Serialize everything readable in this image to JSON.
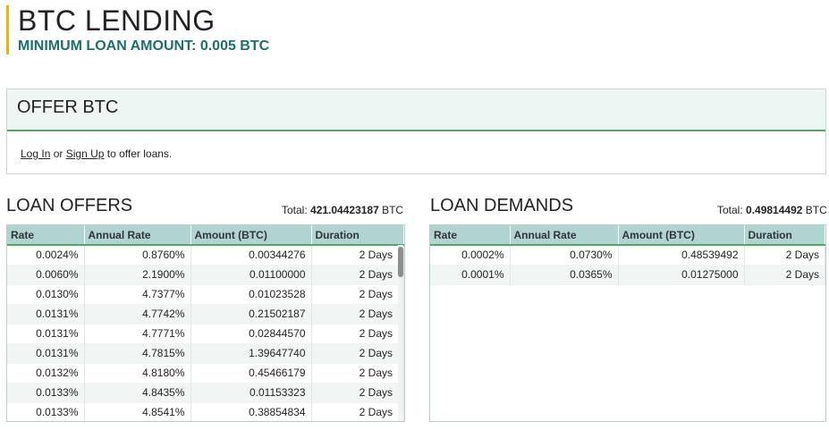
{
  "header": {
    "title": "BTC LENDING",
    "subtitle": "MINIMUM LOAN AMOUNT: 0.005 BTC"
  },
  "offer": {
    "title": "OFFER BTC",
    "login_label": "Log In",
    "or_text": " or ",
    "signup_label": "Sign Up",
    "suffix_text": " to offer loans."
  },
  "loan_offers": {
    "title": "LOAN OFFERS",
    "total_label": "Total: ",
    "total_value": "421.04423187",
    "total_unit": " BTC",
    "columns": [
      "Rate",
      "Annual Rate",
      "Amount (BTC)",
      "Duration"
    ],
    "rows": [
      [
        "0.0024%",
        "0.8760%",
        "0.00344276",
        "2 Days"
      ],
      [
        "0.0060%",
        "2.1900%",
        "0.01100000",
        "2 Days"
      ],
      [
        "0.0130%",
        "4.7377%",
        "0.01023528",
        "2 Days"
      ],
      [
        "0.0131%",
        "4.7742%",
        "0.21502187",
        "2 Days"
      ],
      [
        "0.0131%",
        "4.7771%",
        "0.02844570",
        "2 Days"
      ],
      [
        "0.0131%",
        "4.7815%",
        "1.39647740",
        "2 Days"
      ],
      [
        "0.0132%",
        "4.8180%",
        "0.45466179",
        "2 Days"
      ],
      [
        "0.0133%",
        "4.8435%",
        "0.01153323",
        "2 Days"
      ],
      [
        "0.0133%",
        "4.8541%",
        "0.38854834",
        "2 Days"
      ]
    ]
  },
  "loan_demands": {
    "title": "LOAN DEMANDS",
    "total_label": "Total: ",
    "total_value": "0.49814492",
    "total_unit": " BTC",
    "columns": [
      "Rate",
      "Annual Rate",
      "Amount (BTC)",
      "Duration"
    ],
    "rows": [
      [
        "0.0002%",
        "0.0730%",
        "0.48539492",
        "2 Days"
      ],
      [
        "0.0001%",
        "0.0365%",
        "0.01275000",
        "2 Days"
      ]
    ]
  }
}
